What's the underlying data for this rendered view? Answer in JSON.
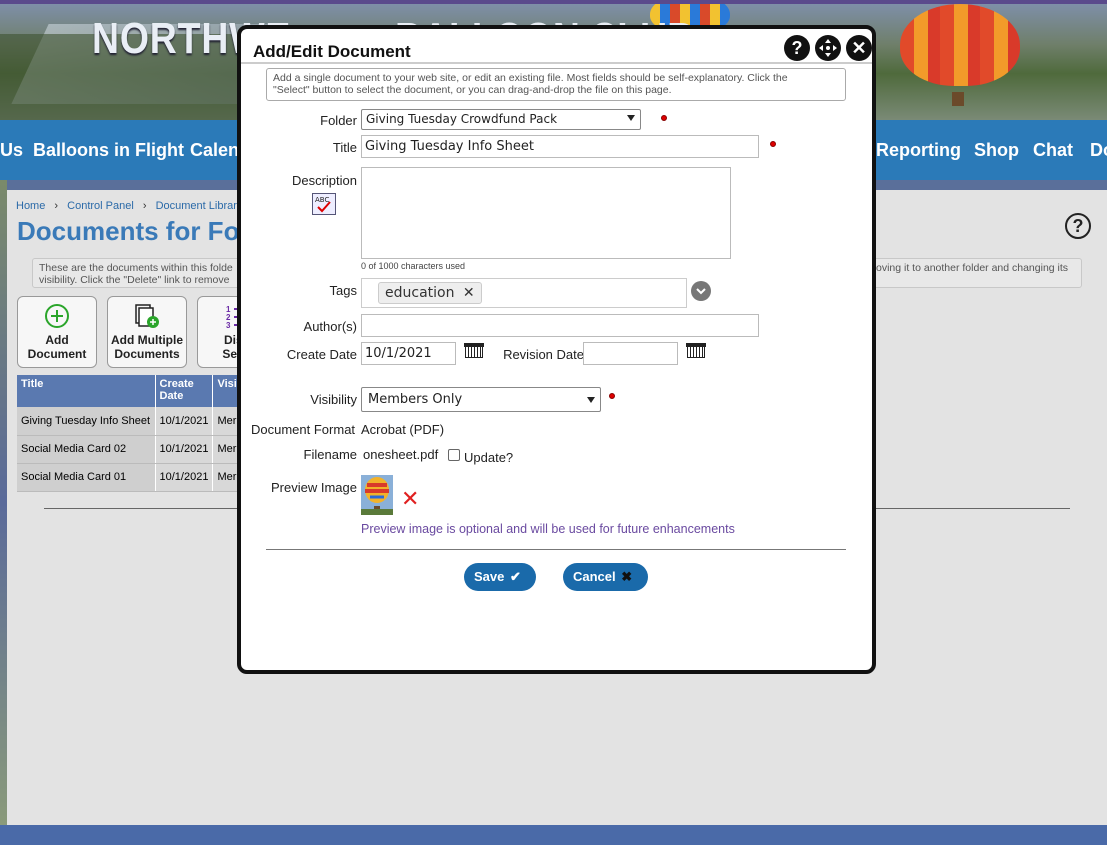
{
  "banner": {
    "logo_left": "NORTHWE",
    "logo_right": "BALLOON CLUB"
  },
  "nav": {
    "items": [
      "Us",
      "Balloons in Flight",
      "Calend",
      "Reporting",
      "Shop",
      "Chat",
      "Do"
    ]
  },
  "breadcrumbs": {
    "home": "Home",
    "control_panel": "Control Panel",
    "doc_library": "Document Library"
  },
  "page": {
    "title": "Documents for Fo",
    "info_line1": "These are the documents within this folde",
    "info_line2": "visibility. Click the \"Delete\" link to remove",
    "info_right": "oving it to another folder and changing its",
    "help": "?"
  },
  "toolbar": {
    "add_document": "Add Document",
    "add_multiple": "Add Multiple Documents",
    "display_seq_1": "Disp",
    "display_seq_2": "Sequ"
  },
  "table": {
    "headers": [
      "Title",
      "Create Date",
      "Visi"
    ],
    "rows": [
      [
        "Giving Tuesday Info Sheet",
        "10/1/2021",
        "Mer"
      ],
      [
        "Social Media Card 02",
        "10/1/2021",
        "Mer"
      ],
      [
        "Social Media Card 01",
        "10/1/2021",
        "Mer"
      ]
    ]
  },
  "modal": {
    "title": "Add/Edit Document",
    "intro_line1": "Add a single document to your web site, or edit an existing file. Most fields should be self-explanatory. Click the",
    "intro_line2": "\"Select\" button to select the document, or you can drag-and-drop the file on this page.",
    "folder_label": "Folder",
    "folder_value": "Giving Tuesday Crowdfund Pack",
    "title_label": "Title",
    "title_value": "Giving Tuesday Info Sheet",
    "description_label": "Description",
    "description_value": "",
    "char_count": "0 of 1000 characters used",
    "tags_label": "Tags",
    "tag_education": "education",
    "authors_label": "Author(s)",
    "authors_value": "",
    "create_date_label": "Create Date",
    "create_date_value": "10/1/2021",
    "revision_date_label": "Revision Date",
    "revision_date_value": "",
    "visibility_label": "Visibility",
    "visibility_value": "Members Only",
    "doc_format_label": "Document Format",
    "doc_format_value": "Acrobat (PDF)",
    "filename_label": "Filename",
    "filename_value": "onesheet.pdf",
    "update_label": "Update?",
    "preview_label": "Preview Image",
    "preview_note": "Preview image is optional and will be used for future enhancements",
    "save": "Save",
    "cancel": "Cancel"
  },
  "colors": {
    "nav": "#2b7ab8",
    "primary_button": "#1a6aaa",
    "required": "#dd0000",
    "title_blue": "#3a7ab8"
  }
}
